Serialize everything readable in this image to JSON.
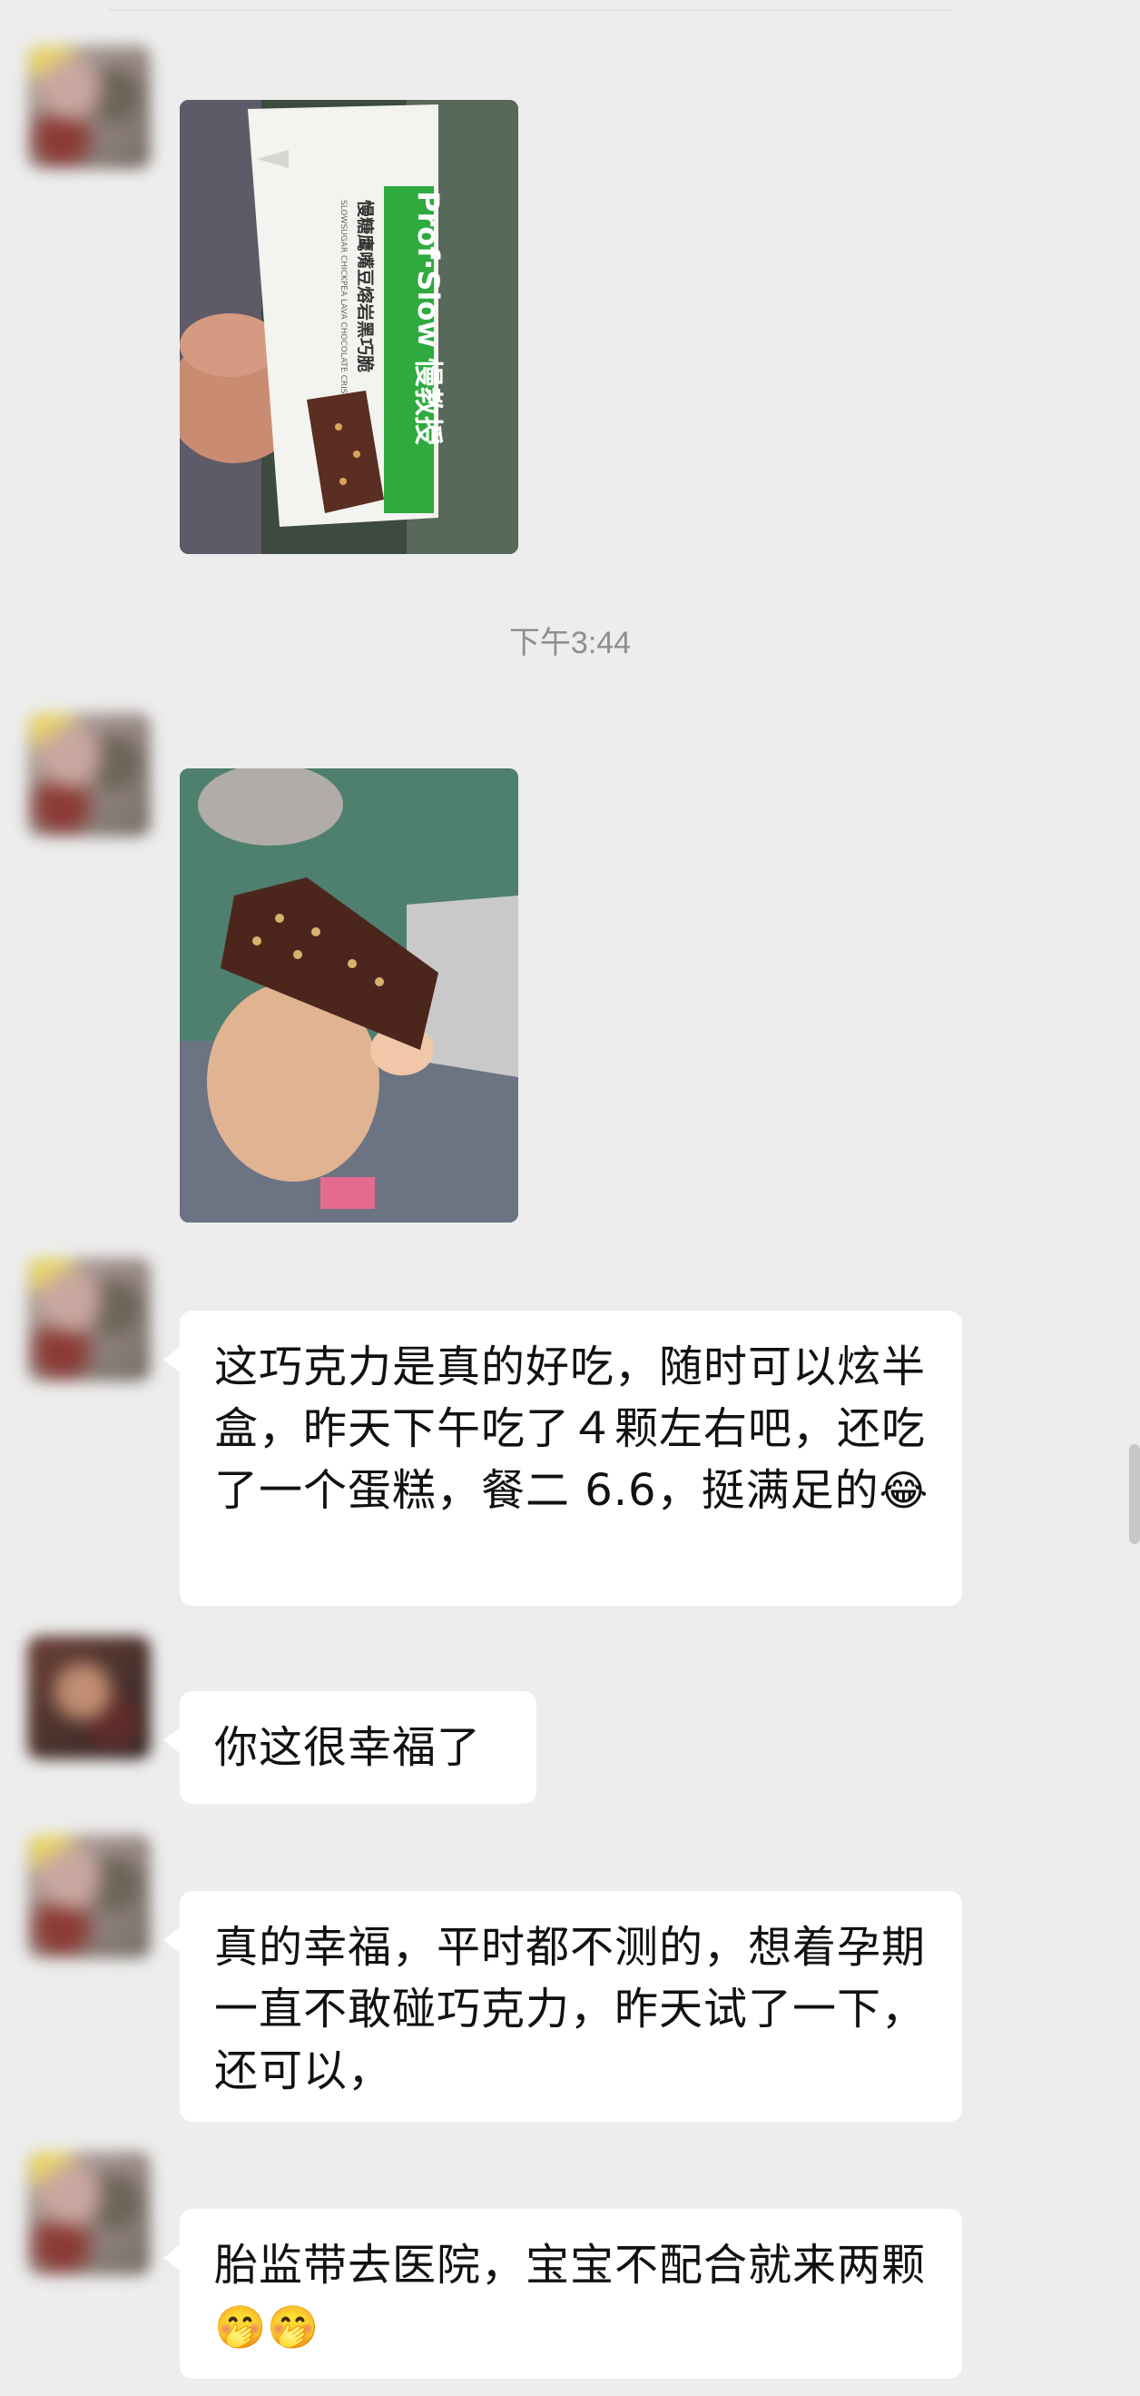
{
  "timestamp": "下午3:44",
  "photo1": {
    "box_brand": "Prof·Slow 慢教授",
    "box_title": "慢糖鹰嘴豆熔岩黑巧脆",
    "box_subtitle": "SLOWSUGAR CHICKPEA LAVA CHOCOLATE CRISPS"
  },
  "messages": [
    {
      "text": "这巧克力是真的好吃，随时可以炫半盒，昨天下午吃了４颗左右吧，还吃了一个蛋糕，餐二 6.6，挺满足的",
      "emoji": "😂"
    },
    {
      "text": "你这很幸福了"
    },
    {
      "text": "真的幸福，平时都不测的，想着孕期一直不敢碰巧克力，昨天试了一下，还可以，",
      "emoji": ""
    },
    {
      "text": "胎监带去医院，宝宝不配合就来两颗",
      "emoji": "🤭🤭"
    }
  ],
  "colors": {
    "background": "#ededed",
    "bubble": "#ffffff",
    "text": "#111111",
    "timestamp": "#8f8f8f",
    "brand_green": "#2eaa3f"
  }
}
